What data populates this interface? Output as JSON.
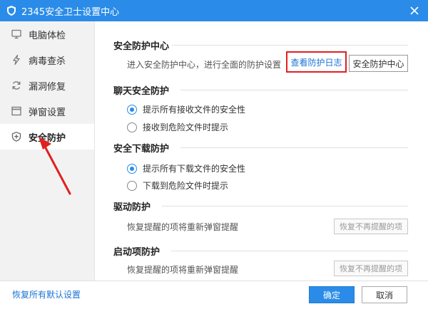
{
  "window": {
    "title": "2345安全卫士设置中心"
  },
  "sidebar": {
    "items": [
      {
        "label": "电脑体检",
        "icon": "monitor-icon"
      },
      {
        "label": "病毒查杀",
        "icon": "lightning-icon"
      },
      {
        "label": "漏洞修复",
        "icon": "refresh-icon"
      },
      {
        "label": "弹窗设置",
        "icon": "window-icon"
      },
      {
        "label": "安全防护",
        "icon": "shield-icon",
        "active": true
      }
    ]
  },
  "sections": {
    "center": {
      "title": "安全防护中心",
      "desc": "进入安全防护中心，进行全面的防护设置",
      "log_link": "查看防护日志",
      "center_button": "安全防护中心"
    },
    "chat": {
      "title": "聊天安全防护",
      "options": [
        "提示所有接收文件的安全性",
        "接收到危险文件时提示"
      ]
    },
    "download": {
      "title": "安全下载防护",
      "options": [
        "提示所有下载文件的安全性",
        "下载到危险文件时提示"
      ]
    },
    "driver": {
      "title": "驱动防护",
      "desc": "恢复提醒的项将重新弹窗提醒",
      "button": "恢复不再提醒的项"
    },
    "startup": {
      "title": "启动项防护",
      "desc": "恢复提醒的项将重新弹窗提醒",
      "button": "恢复不再提醒的项"
    }
  },
  "footer": {
    "restore_defaults": "恢复所有默认设置",
    "ok": "确定",
    "cancel": "取消"
  },
  "colors": {
    "accent": "#2a8ce8",
    "highlight": "#e02020"
  }
}
